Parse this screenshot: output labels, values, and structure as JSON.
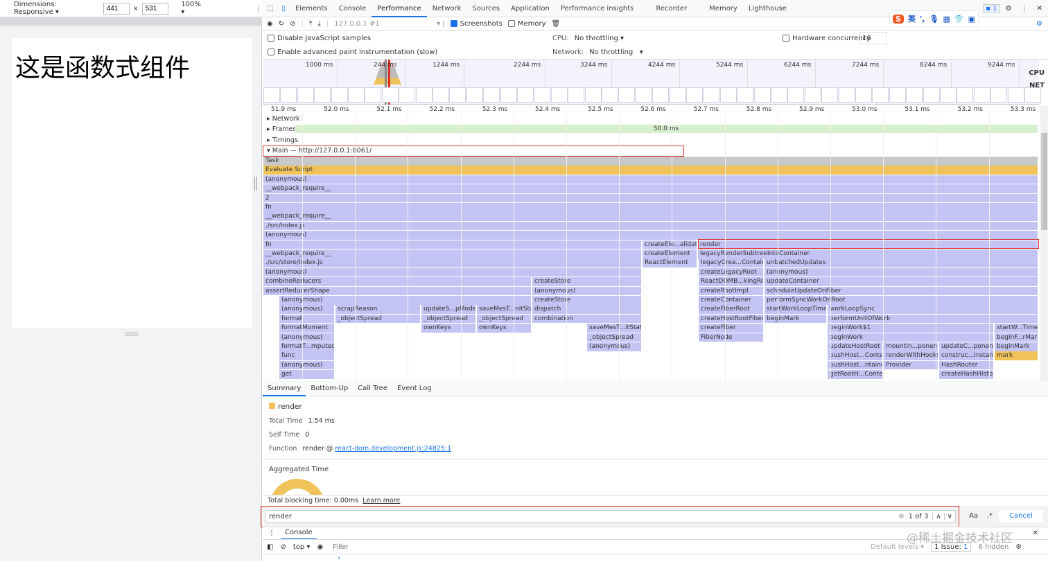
{
  "device": {
    "dimensions": "Dimensions: Responsive",
    "width": "441",
    "height": "531",
    "zoom": "100%",
    "page_heading": "这是函数式组件"
  },
  "devtools": {
    "tabs": [
      "Elements",
      "Console",
      "Performance",
      "Network",
      "Sources",
      "Application",
      "Performance insights",
      "Recorder",
      "Memory",
      "Lighthouse"
    ],
    "active_tab": "Performance",
    "issues_badge": "1",
    "ime": "英",
    "recording": "127.0.0.1 #1",
    "screenshots": "Screenshots",
    "memory": "Memory",
    "disable_js": "Disable JavaScript samples",
    "adv_paint": "Enable advanced paint instrumentation (slow)",
    "cpu_label": "CPU:",
    "cpu_value": "No throttling",
    "net_label": "Network:",
    "net_value": "No throttling",
    "hw_label": "Hardware concurrency",
    "hw_value": "16"
  },
  "overview": {
    "ticks": [
      "1000 ms",
      "244 ms",
      "1244 ms",
      "2244 ms",
      "3244 ms",
      "4244 ms",
      "5244 ms",
      "6244 ms",
      "7244 ms",
      "8244 ms",
      "9244 ms"
    ],
    "cpu": "CPU",
    "net": "NET"
  },
  "timeline": {
    "ticks": [
      "51.9 ms",
      "52.0 ms",
      "52.1 ms",
      "52.2 ms",
      "52.3 ms",
      "52.4 ms",
      "52.5 ms",
      "52.6 ms",
      "52.7 ms",
      "52.8 ms",
      "52.9 ms",
      "53.0 ms",
      "53.1 ms",
      "53.2 ms",
      "53.3 ms"
    ]
  },
  "tracks": {
    "network": "Network",
    "frames": "Frames",
    "frame_time": "50.0 ms",
    "timings": "Timings",
    "main": "Main — http://127.0.0.1:8061/"
  },
  "flame": {
    "colors": {
      "task": "#c8c8c8",
      "script": "#f0c35a",
      "js": "#c3c4f4",
      "mark": "#f0c35a"
    },
    "rows": [
      [
        "Task"
      ],
      [
        "Evaluate Script"
      ],
      [
        "(anonymous)"
      ],
      [
        "__webpack_require__"
      ],
      [
        "2"
      ],
      [
        "fn"
      ],
      [
        "__webpack_require__"
      ],
      [
        "./src/index.js"
      ],
      [
        "(anonymous)"
      ],
      [
        "fn",
        "createEle...alidation",
        "render"
      ],
      [
        "__webpack_require__",
        "createElement",
        "legacyRenderSubtreeIntoContainer"
      ],
      [
        "./src/store/index.js",
        "ReactElement",
        "legacyCrea...Container",
        "unbatchedUpdates"
      ],
      [
        "(anonymous)",
        "createLegacyRoot",
        "(anonymous)"
      ],
      [
        "combineReducers",
        "createStore",
        "ReactDOMB...kingRoot",
        "updateContainer"
      ],
      [
        "assertReducerShape",
        "(anonymous)",
        "createRootImpl",
        "scheduleUpdateOnFiber"
      ],
      [
        "(anonymous)",
        "createStore",
        "createContainer",
        "performSyncWorkOnRoot"
      ],
      [
        "(anonymous)",
        "scrapReason",
        "updateS...pModel",
        "saveMesT...nitState",
        "dispatch",
        "createFiberRoot",
        "startWorkLoopTimer",
        "workLoopSync"
      ],
      [
        "format",
        "_objectSpread",
        "_objectSpread",
        "_objectSpread",
        "combination",
        "createHostRootFiber",
        "beginMark",
        "performUnitOfWork"
      ],
      [
        "formatMoment",
        "ownKeys",
        "ownKeys",
        "saveMesT...itState",
        "createFiber",
        "beginWork$1",
        "startW...Timer"
      ],
      [
        "(anonymous)",
        "_objectSpread",
        "FiberNode",
        "beginWork",
        "beginF...rMark"
      ],
      [
        "formatT...mputed>",
        "(anonymous)",
        "updateHostRoot",
        "mountIn...ponent",
        "updateC...ponent",
        "beginMark"
      ],
      [
        "func",
        "pushHost...Context",
        "renderWithHooks",
        "construc...Instance",
        "mark"
      ],
      [
        "(anonymous)",
        "pushHost...ntainer",
        "Provider",
        "HashRouter"
      ],
      [
        "get",
        "getRootH...Context",
        "createHashHistory"
      ]
    ]
  },
  "bottom": {
    "tabs": [
      "Summary",
      "Bottom-Up",
      "Call Tree",
      "Event Log"
    ],
    "active": "Summary",
    "summary": {
      "name": "render",
      "total_label": "Total Time",
      "total": "1.54 ms",
      "self_label": "Self Time",
      "self": "0",
      "fn_label": "Function",
      "fn": "render @",
      "link": "react-dom.development.js:24825:1",
      "aggregated": "Aggregated Time"
    },
    "tbt": "Total blocking time: 0.00ms",
    "learn_more": "Learn more"
  },
  "search": {
    "value": "render",
    "count": "1 of 3",
    "case": "Aa",
    "regex": ".*",
    "cancel": "Cancel"
  },
  "console": {
    "tab": "Console",
    "context": "top",
    "filter_placeholder": "Filter",
    "levels": "Default levels",
    "issues": "1 Issue:",
    "issues_count": "1",
    "hidden": "6 hidden"
  },
  "watermark": "@稀土掘金技术社区"
}
